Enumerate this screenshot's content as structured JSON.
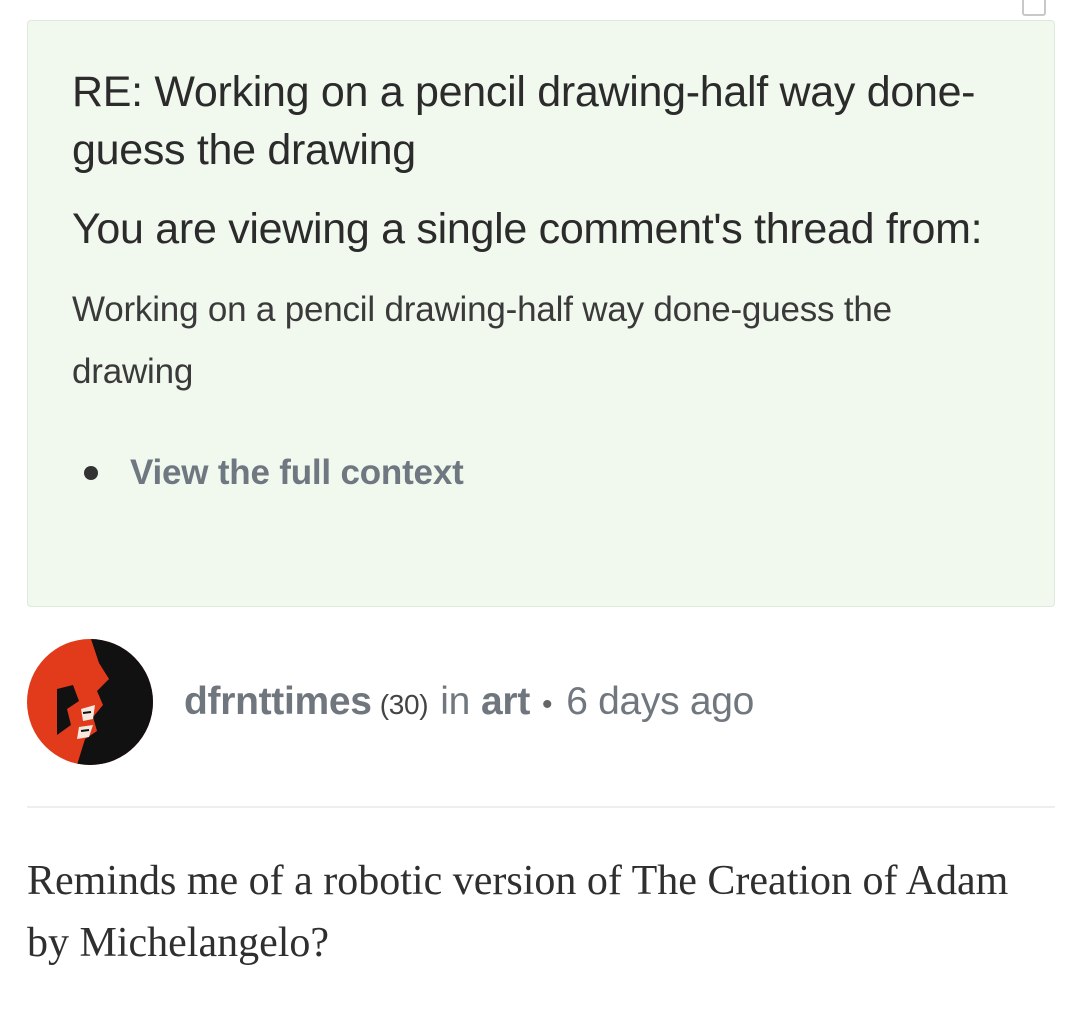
{
  "context": {
    "title": "RE: Working on a pencil drawing-half way done-guess the drawing",
    "subtitle": "You are viewing a single comment's thread from:",
    "parent_post": "Working on a pencil drawing-half way done-guess the drawing",
    "links": [
      {
        "label": "View the full context"
      }
    ]
  },
  "post": {
    "author": "dfrnttimes",
    "reputation": "(30)",
    "in_word": "in",
    "category": "art",
    "separator": "•",
    "timestamp": "6 days ago",
    "avatar_icon": "red-black-face-avatar",
    "body": "Reminds me of a robotic version of The Creation of Adam by Michelangelo?"
  },
  "colors": {
    "context_background": "#f1f8ee",
    "meta_text": "#70777f",
    "avatar_red": "#e23b1c",
    "avatar_black": "#111111"
  }
}
